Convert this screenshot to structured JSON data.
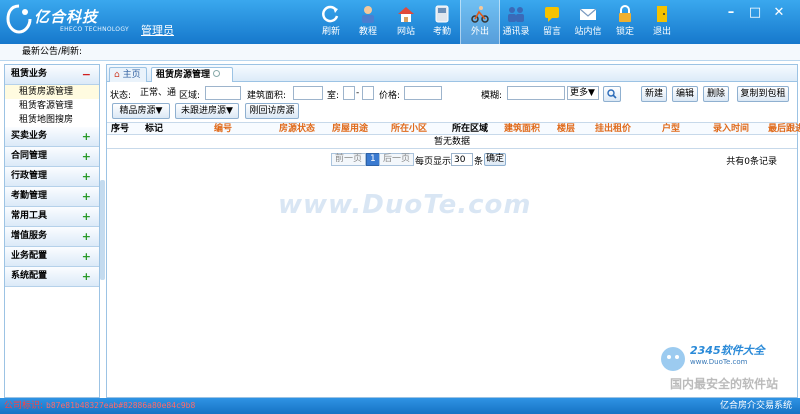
{
  "app": {
    "brand_cn": "亿合科技",
    "brand_en": "EHECO TECHNOLOGY",
    "role": "管理员"
  },
  "toolbar": [
    {
      "label": "刷新",
      "icon": "refresh-icon"
    },
    {
      "label": "教程",
      "icon": "tutorial-icon"
    },
    {
      "label": "网站",
      "icon": "home-icon"
    },
    {
      "label": "考勤",
      "icon": "attendance-icon"
    },
    {
      "label": "外出",
      "icon": "go-out-icon"
    },
    {
      "label": "通讯录",
      "icon": "contacts-icon"
    },
    {
      "label": "留言",
      "icon": "message-icon"
    },
    {
      "label": "站内信",
      "icon": "mail-icon"
    },
    {
      "label": "锁定",
      "icon": "lock-icon"
    },
    {
      "label": "退出",
      "icon": "exit-icon"
    }
  ],
  "notice": "最新公告/刷新:",
  "sidebar": {
    "sections": [
      {
        "label": "租赁业务",
        "toggle": "−",
        "items": [
          "租赁房源管理",
          "租赁客源管理",
          "租赁地图搜房"
        ]
      },
      {
        "label": "买卖业务",
        "toggle": "+"
      },
      {
        "label": "合同管理",
        "toggle": "+"
      },
      {
        "label": "行政管理",
        "toggle": "+"
      },
      {
        "label": "考勤管理",
        "toggle": "+"
      },
      {
        "label": "常用工具",
        "toggle": "+"
      },
      {
        "label": "增值服务",
        "toggle": "+"
      },
      {
        "label": "业务配置",
        "toggle": "+"
      },
      {
        "label": "系统配置",
        "toggle": "+"
      }
    ]
  },
  "tabs": {
    "home": "主页",
    "current": "租赁房源管理"
  },
  "filters": {
    "status_label": "状态:",
    "status_value": "正常、通",
    "area_label": "区域:",
    "build_area_label": "建筑面积:",
    "room_label": "室:",
    "range_sep": "-",
    "price_label": "价格:",
    "fuzzy_label": "模糊:",
    "more_value": "更多▼",
    "new": "新建",
    "edit": "编辑",
    "delete": "删除",
    "copy": "复制到包租"
  },
  "quick": {
    "quality": "精品房源▼",
    "unfollowed": "未跟进房源▼",
    "revisit": "刚回访房源"
  },
  "grid": {
    "columns": [
      "序号",
      "标记",
      "编号",
      "房源状态",
      "房屋用途",
      "所在小区",
      "所在区域",
      "建筑面积",
      "楼层",
      "挂出租价",
      "户型",
      "录入时间",
      "最后跟进"
    ],
    "empty_text": "暂无数据"
  },
  "pager": {
    "prev": "前一页",
    "page": "1",
    "next": "后一页",
    "per_page_label": "每页显示",
    "per_page_value": "30",
    "unit": "条",
    "confirm": "确定",
    "total": "共有0条记录"
  },
  "watermark": {
    "center": "www.DuoTe.com",
    "logo_text": "2345软件大全",
    "logo_url": "www.DuoTe.com",
    "slogan": "国内最安全的软件站"
  },
  "status": {
    "label": "公司标识:",
    "code": "b87e81b48327eab#82886a80e84c9b8",
    "right": "亿合房介交易系统"
  },
  "colors": {
    "titlebar": "#1d84d6",
    "accent": "#3a7ad0",
    "header_highlight": "#e06a1a"
  }
}
